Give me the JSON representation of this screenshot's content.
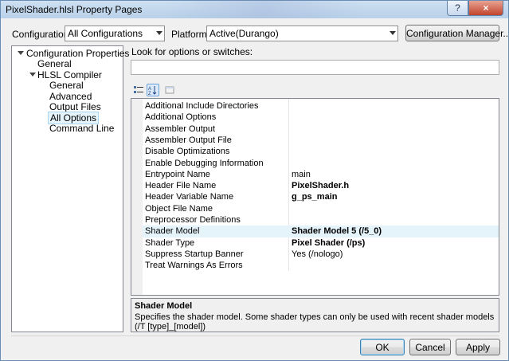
{
  "window": {
    "title": "PixelShader.hlsl Property Pages"
  },
  "title_buttons": {
    "help": "?",
    "close": "×"
  },
  "configuration": {
    "label": "Configuration:",
    "value": "All Configurations"
  },
  "platform": {
    "label": "Platform:",
    "value": "Active(Durango)"
  },
  "config_manager_label": "Configuration Manager...",
  "tree": {
    "root": "Configuration Properties",
    "general": "General",
    "hlsl": "HLSL Compiler",
    "children": [
      "General",
      "Advanced",
      "Output Files",
      "All Options",
      "Command Line"
    ],
    "selected": "All Options"
  },
  "search": {
    "label": "Look for options or switches:",
    "value": ""
  },
  "toolbar_icons": [
    "categorized-icon",
    "alphabetical-icon",
    "property-pages-icon"
  ],
  "properties": [
    {
      "name": "Additional Include Directories",
      "value": "",
      "bold": false
    },
    {
      "name": "Additional Options",
      "value": "",
      "bold": false
    },
    {
      "name": "Assembler Output",
      "value": "",
      "bold": false
    },
    {
      "name": "Assembler Output File",
      "value": "",
      "bold": false
    },
    {
      "name": "Disable Optimizations",
      "value": "",
      "bold": false
    },
    {
      "name": "Enable Debugging Information",
      "value": "",
      "bold": false
    },
    {
      "name": "Entrypoint Name",
      "value": "main",
      "bold": false
    },
    {
      "name": "Header File Name",
      "value": "PixelShader.h",
      "bold": true
    },
    {
      "name": "Header Variable Name",
      "value": "g_ps_main",
      "bold": true
    },
    {
      "name": "Object File Name",
      "value": "",
      "bold": false
    },
    {
      "name": "Preprocessor Definitions",
      "value": "",
      "bold": false
    },
    {
      "name": "Shader Model",
      "value": "Shader Model 5 (/5_0)",
      "bold": true
    },
    {
      "name": "Shader Type",
      "value": "Pixel Shader (/ps)",
      "bold": true
    },
    {
      "name": "Suppress Startup Banner",
      "value": "Yes (/nologo)",
      "bold": false
    },
    {
      "name": "Treat Warnings As Errors",
      "value": "",
      "bold": false
    }
  ],
  "selected_property": "Shader Model",
  "description": {
    "title": "Shader Model",
    "text": "Specifies the shader model. Some shader types can only be used with recent shader models (/T [type]_[model])"
  },
  "buttons": {
    "ok": "OK",
    "cancel": "Cancel",
    "apply": "Apply"
  },
  "colors": {
    "selection": "#e5f3fb",
    "titlebar": "#b9d1ea"
  }
}
